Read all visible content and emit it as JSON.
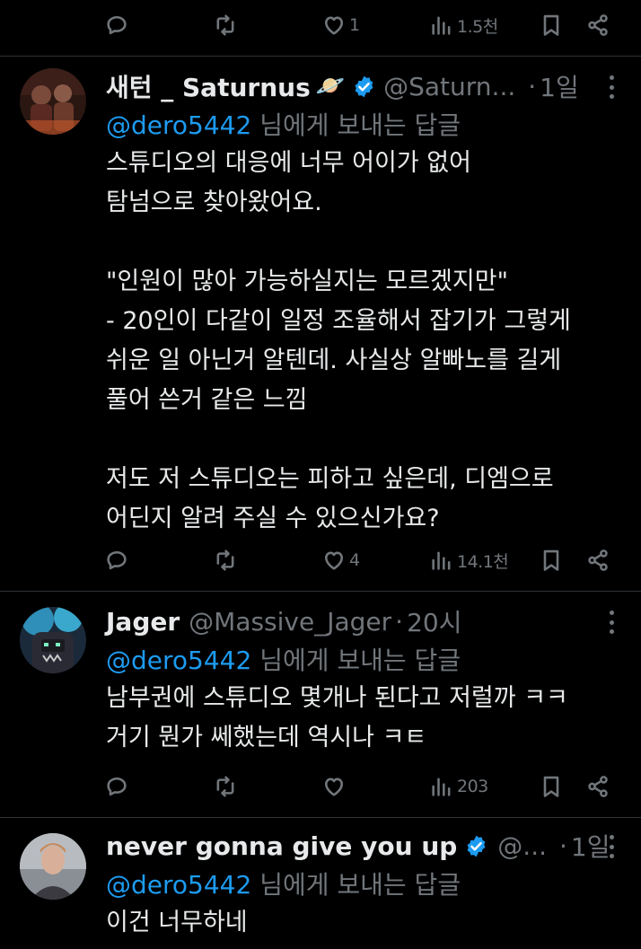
{
  "top_actions": {
    "likes": "1",
    "views": "1.5천"
  },
  "tweets": [
    {
      "name": "새턴 _ Saturnus",
      "emoji": "🪐",
      "handle": "@Saturn...",
      "dot": "·",
      "time": "1일",
      "reply_prefix": "@dero5442",
      "reply_suffix": " 님에게 보내는 답글",
      "text": "스튜디오의 대응에 너무 어이가 없어\n탐넘으로 찾아왔어요.\n\n\"인원이 많아 가능하실지는 모르겠지만\"\n- 20인이 다같이 일정 조율해서 잡기가 그렇게\n쉬운 일 아닌거 알텐데. 사실상 알빠노를 길게\n풀어 쓴거 같은 느낌\n\n저도 저 스튜디오는 피하고 싶은데, 디엠으로\n어딘지 알려 주실 수 있으신가요?",
      "replies": "",
      "retweets": "",
      "likes": "4",
      "views": "14.1천",
      "verified_color": "#1d9bf0"
    },
    {
      "name": "Jager",
      "handle": "@Massive_Jager",
      "dot": "·",
      "time": "20시",
      "reply_prefix": "@dero5442",
      "reply_suffix": " 님에게 보내는 답글",
      "text": "남부권에 스튜디오 몇개나 된다고 저럴까 ㅋㅋ\n거기 뭔가 쎄했는데 역시나 ㅋㅌ",
      "likes": "",
      "views": "203"
    },
    {
      "name": "never gonna give you up",
      "handle": "@...",
      "dot": "·",
      "time": "1일",
      "reply_prefix": "@dero5442",
      "reply_suffix": " 님에게 보내는 답글",
      "text": "이건 너무하네"
    }
  ],
  "colors": {
    "background": "#000000",
    "text": "#e7e9ea",
    "muted": "#71767b",
    "accent": "#1d9bf0",
    "divider": "#2f3336"
  },
  "icons": [
    "reply-icon",
    "retweet-icon",
    "like-icon",
    "views-icon",
    "bookmark-icon",
    "share-icon",
    "verified-badge-icon",
    "more-icon"
  ]
}
